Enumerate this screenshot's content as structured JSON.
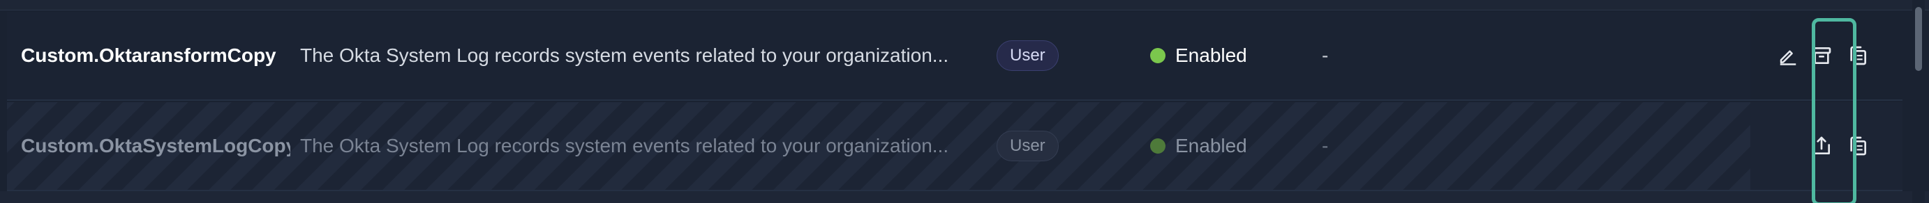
{
  "rows": [
    {
      "name": "Custom.OktaransformCopy",
      "description": "The Okta System Log records system events related to your organization...",
      "tag": "User",
      "status": "Enabled",
      "extra": "-",
      "actions": [
        "edit-icon",
        "archive-icon",
        "copy-icon"
      ]
    },
    {
      "name": "Custom.OktaSystemLogCopy",
      "description": "The Okta System Log records system events related to your organization...",
      "tag": "User",
      "status": "Enabled",
      "extra": "-",
      "actions": [
        "export-icon",
        "copy-icon"
      ]
    }
  ],
  "colors": {
    "background": "#1a2231",
    "enabled": "#7bc74d",
    "highlight": "#4fb8a0",
    "tag_bg": "#262a4a"
  }
}
